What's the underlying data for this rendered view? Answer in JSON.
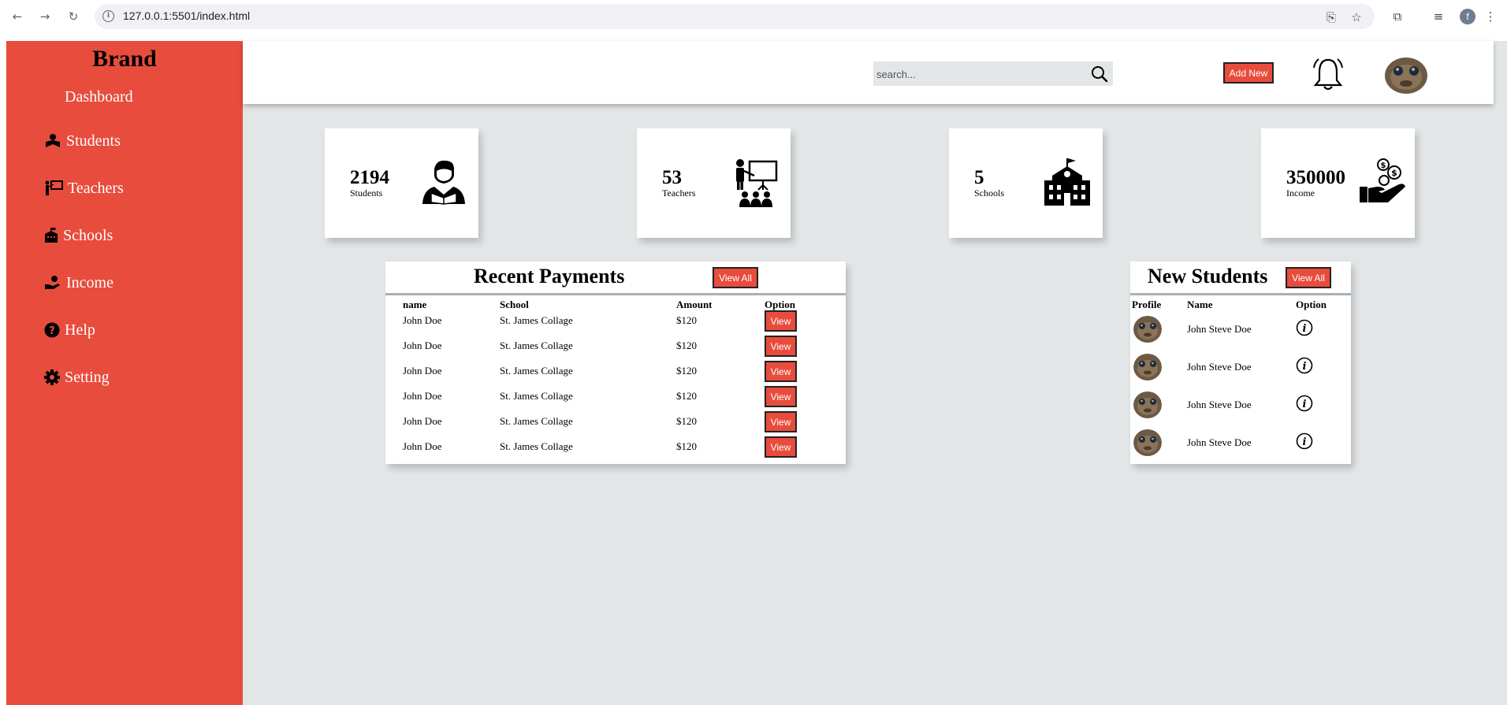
{
  "browser": {
    "url": "127.0.0.1:5501/index.html",
    "profile_initial": "f"
  },
  "sidebar": {
    "brand": "Brand",
    "dashboard": "Dashboard",
    "items": [
      {
        "label": "Students",
        "icon": "student-reading-icon"
      },
      {
        "label": "Teachers",
        "icon": "teacher-board-icon"
      },
      {
        "label": "Schools",
        "icon": "school-building-icon"
      },
      {
        "label": "Income",
        "icon": "hand-coin-icon"
      },
      {
        "label": "Help",
        "icon": "question-circle-icon"
      },
      {
        "label": "Setting",
        "icon": "gear-icon"
      }
    ]
  },
  "topbar": {
    "search_placeholder": "search...",
    "add_new": "Add New"
  },
  "cards": [
    {
      "value": "2194",
      "label": "Students",
      "icon": "student-icon"
    },
    {
      "value": "53",
      "label": "Teachers",
      "icon": "teacher-class-icon"
    },
    {
      "value": "5",
      "label": "Schools",
      "icon": "school-icon"
    },
    {
      "value": "350000",
      "label": "Income",
      "icon": "income-icon"
    }
  ],
  "payments": {
    "title": "Recent Payments",
    "view_all": "View All",
    "headers": [
      "name",
      "School",
      "Amount",
      "Option"
    ],
    "rows": [
      {
        "name": "John Doe",
        "school": "St. James Collage",
        "amount": "$120",
        "option": "View"
      },
      {
        "name": "John Doe",
        "school": "St. James Collage",
        "amount": "$120",
        "option": "View"
      },
      {
        "name": "John Doe",
        "school": "St. James Collage",
        "amount": "$120",
        "option": "View"
      },
      {
        "name": "John Doe",
        "school": "St. James Collage",
        "amount": "$120",
        "option": "View"
      },
      {
        "name": "John Doe",
        "school": "St. James Collage",
        "amount": "$120",
        "option": "View"
      },
      {
        "name": "John Doe",
        "school": "St. James Collage",
        "amount": "$120",
        "option": "View"
      }
    ]
  },
  "new_students": {
    "title": "New Students",
    "view_all": "View All",
    "headers": [
      "Profile",
      "Name",
      "Option"
    ],
    "rows": [
      {
        "name": "John Steve Doe"
      },
      {
        "name": "John Steve Doe"
      },
      {
        "name": "John Steve Doe"
      },
      {
        "name": "John Steve Doe"
      }
    ]
  },
  "colors": {
    "accent": "#e84c3d",
    "background": "#e3e6e7",
    "card": "#ffffff"
  }
}
